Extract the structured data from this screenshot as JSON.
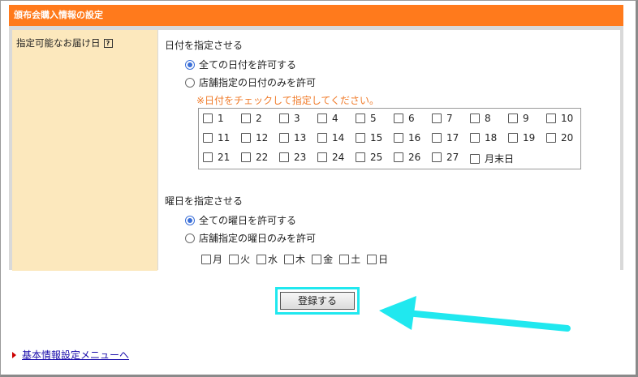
{
  "panel": {
    "title": "頒布会購入情報の設定",
    "field_label": "指定可能なお届け日",
    "help_icon": "?"
  },
  "date_section": {
    "title": "日付を指定させる",
    "options": [
      {
        "label": "全ての日付を許可する",
        "checked": true
      },
      {
        "label": "店舗指定の日付のみを許可",
        "checked": false
      }
    ],
    "note": "※日付をチェックして指定してください。",
    "days": [
      "1",
      "2",
      "3",
      "4",
      "5",
      "6",
      "7",
      "8",
      "9",
      "10",
      "11",
      "12",
      "13",
      "14",
      "15",
      "16",
      "17",
      "18",
      "19",
      "20",
      "21",
      "22",
      "23",
      "24",
      "25",
      "26",
      "27",
      "月末日"
    ]
  },
  "weekday_section": {
    "title": "曜日を指定させる",
    "options": [
      {
        "label": "全ての曜日を許可する",
        "checked": true
      },
      {
        "label": "店舗指定の曜日のみを許可",
        "checked": false
      }
    ],
    "weekdays": [
      "月",
      "火",
      "水",
      "木",
      "金",
      "土",
      "日"
    ]
  },
  "submit_label": "登録する",
  "footer_link": "基本情報設定メニューへ",
  "colors": {
    "header": "#ff7a1c",
    "label_bg": "#fce8bd",
    "note": "#f07a28",
    "highlight": "#20e8ef",
    "link": "#1a0dab"
  }
}
